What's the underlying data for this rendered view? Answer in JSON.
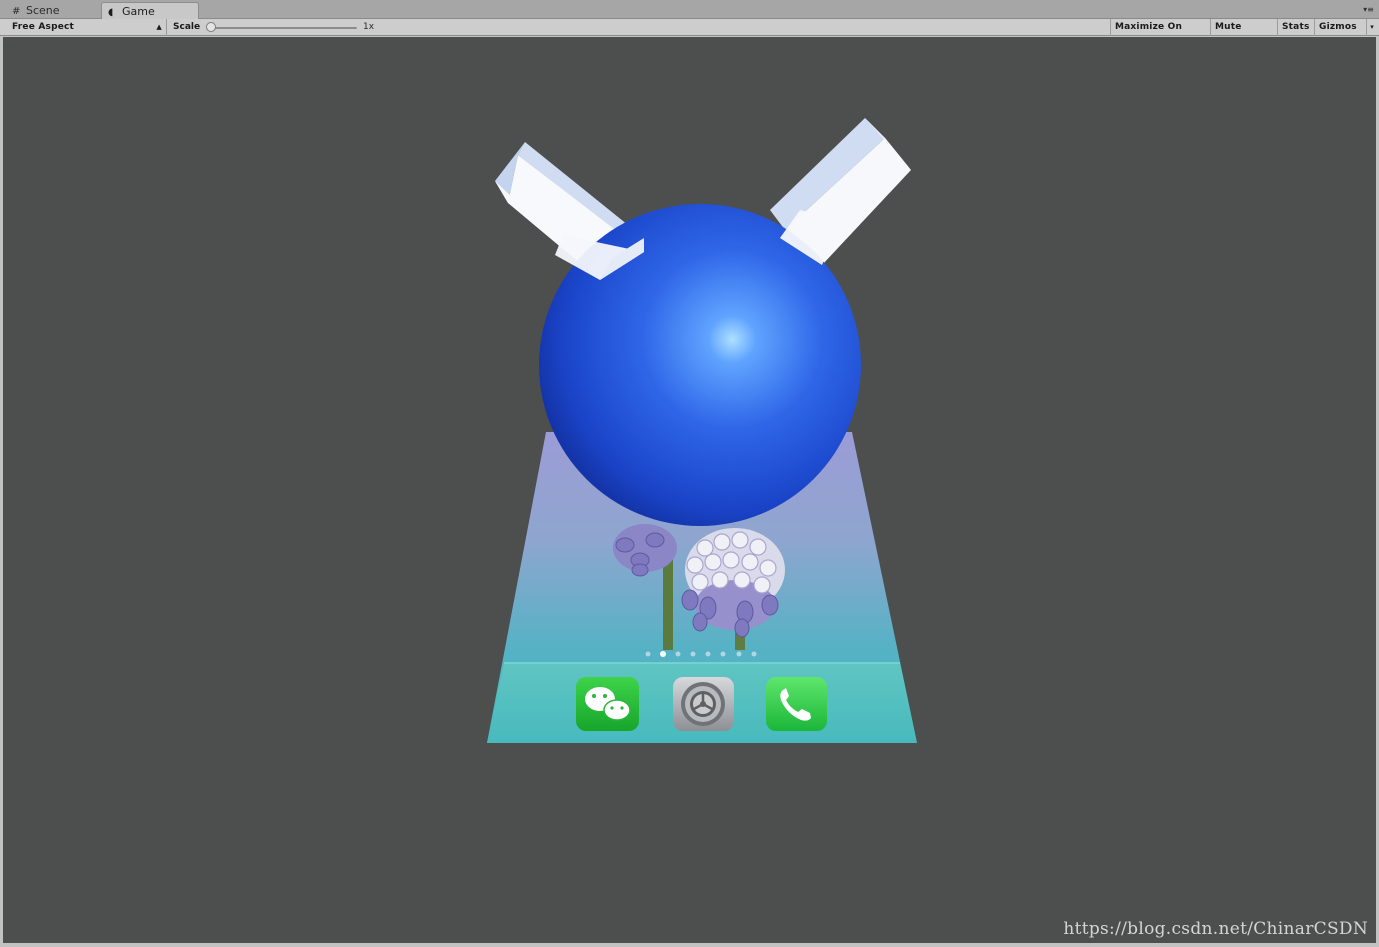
{
  "tabs": [
    {
      "label": "Scene",
      "icon": "grid-icon",
      "active": false
    },
    {
      "label": "Game",
      "icon": "game-controller-icon",
      "active": true
    }
  ],
  "toolbar": {
    "aspect": "Free Aspect",
    "scale_label": "Scale",
    "scale_value": "1x",
    "buttons": {
      "maximize": "Maximize On Play",
      "mute": "Mute Audio",
      "stats": "Stats",
      "gizmos": "Gizmos"
    }
  },
  "game_view": {
    "background": "#4d4f4f",
    "sphere_color": "#2f66e8",
    "dock_apps": [
      "wechat-icon",
      "settings-icon",
      "phone-icon"
    ],
    "page_dots": 8,
    "active_page_dot": 2
  },
  "watermark": "https://blog.csdn.net/ChinarCSDN"
}
